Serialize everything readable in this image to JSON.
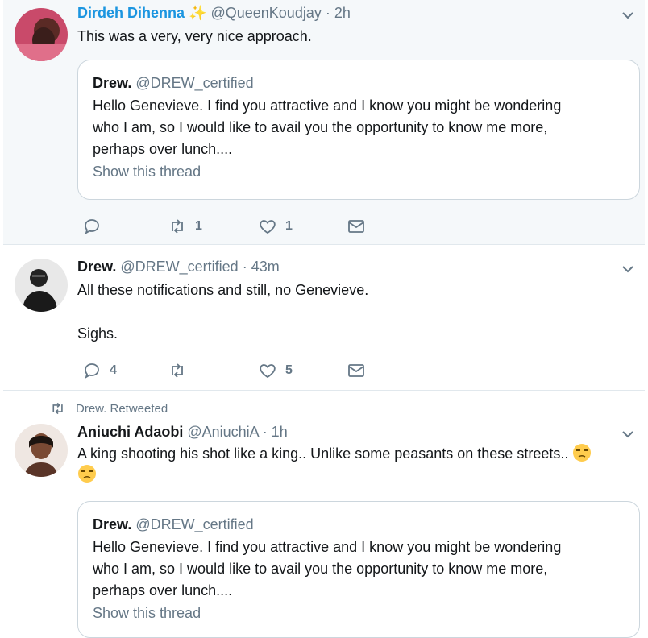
{
  "tweets": [
    {
      "name": "Dirdeh Dihenna",
      "name_emoji": "✨",
      "handle": "@QueenKoudjay",
      "time": "· 2h",
      "text": "This was a very, very nice approach.",
      "quote": {
        "name": "Drew.",
        "handle": "@DREW_certified",
        "lines": [
          "Hello Genevieve. I find you attractive and I know you might be wondering",
          "who I am, so I would like to avail you the opportunity to know me more,",
          "perhaps over lunch...."
        ],
        "show_thread": "Show this thread"
      },
      "replies": "",
      "retweets": "1",
      "likes": "1"
    },
    {
      "name": "Drew.",
      "handle": "@DREW_certified",
      "time": "· 43m",
      "line1": "All these notifications and still, no Genevieve.",
      "line2": "Sighs.",
      "replies": "4",
      "retweets": "",
      "likes": "5"
    },
    {
      "retweeted_by": "Drew. Retweeted",
      "name": "Aniuchi Adaobi",
      "handle": "@AniuchiA",
      "time": "· 1h",
      "text": "A king shooting his shot like a king.. Unlike some peasants on these streets..",
      "quote": {
        "name": "Drew.",
        "handle": "@DREW_certified",
        "lines": [
          "Hello Genevieve. I find you attractive and I know you might be wondering",
          "who I am, so I would like to avail you the opportunity to know me more,",
          "perhaps over lunch...."
        ],
        "show_thread": "Show this thread"
      }
    }
  ],
  "icons": {
    "reply": "reply-icon",
    "retweet": "retweet-icon",
    "like": "heart-icon",
    "message": "envelope-icon",
    "caret": "chevron-down-icon",
    "emoji": "unamused-face-emoji"
  },
  "colors": {
    "link": "#1b95e0",
    "muted": "#657786",
    "action": "#657786",
    "highlight_bg": "#f5f8fa"
  }
}
